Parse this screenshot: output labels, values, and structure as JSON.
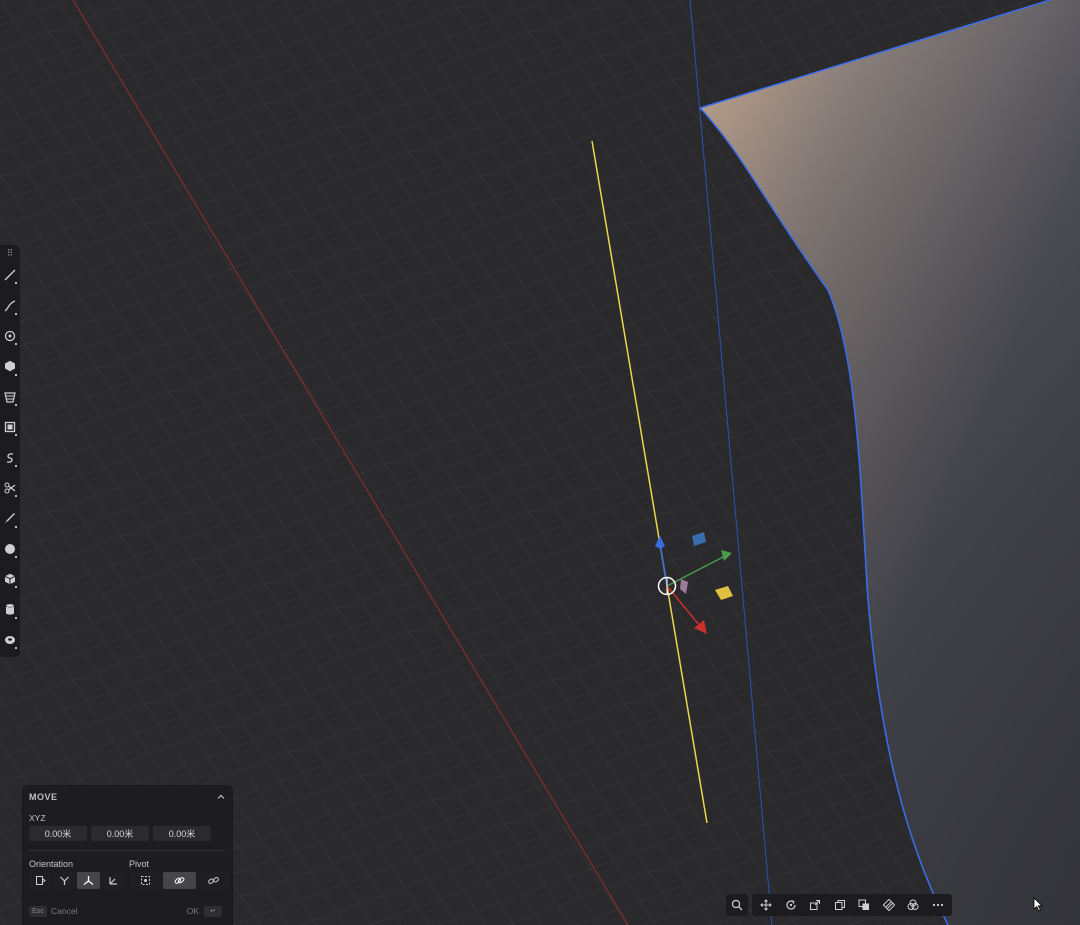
{
  "viewport": {
    "background": "#2a2a2c",
    "grid_color": "#3a3a3d",
    "x_axis_color": "#b03030",
    "y_axis_color": "#2f58c8",
    "selected_curve_color": "#e8d74a",
    "surface_edge_color": "#3a6df0"
  },
  "gizmo": {
    "x_color": "#c8302c",
    "y_color": "#4a9a4a",
    "z_color": "#3a6de0",
    "plane_colors": [
      "#3a6db0",
      "#e0c040",
      "#9a7a9a"
    ]
  },
  "toolbar": {
    "grip_glyph": "⠿",
    "tools": [
      {
        "name": "line-tool-icon"
      },
      {
        "name": "curve-tool-icon"
      },
      {
        "name": "circle-tool-icon"
      },
      {
        "name": "polygon-tool-icon"
      },
      {
        "name": "loft-tool-icon"
      },
      {
        "name": "box-select-tool-icon"
      },
      {
        "name": "spiral-tool-icon"
      },
      {
        "name": "cut-tool-icon"
      },
      {
        "name": "sketch-tool-icon"
      },
      {
        "name": "sphere-tool-icon"
      },
      {
        "name": "cube-tool-icon"
      },
      {
        "name": "cylinder-tool-icon"
      },
      {
        "name": "torus-tool-icon"
      }
    ]
  },
  "move_panel": {
    "title": "MOVE",
    "coord_label": "XYZ",
    "values": [
      "0.00米",
      "0.00米",
      "0.00米"
    ],
    "orientation_label": "Orientation",
    "pivot_label": "Pivot",
    "esc_key": "Esc",
    "cancel_label": "Cancel",
    "ok_label": "OK",
    "enter_key": "↵"
  },
  "bottom_toolbar": {
    "icons": [
      "search-icon",
      "move-icon",
      "rotate-icon",
      "scale-icon",
      "copy-icon",
      "boolean-icon",
      "material-icon",
      "render-icon",
      "more-icon"
    ]
  }
}
